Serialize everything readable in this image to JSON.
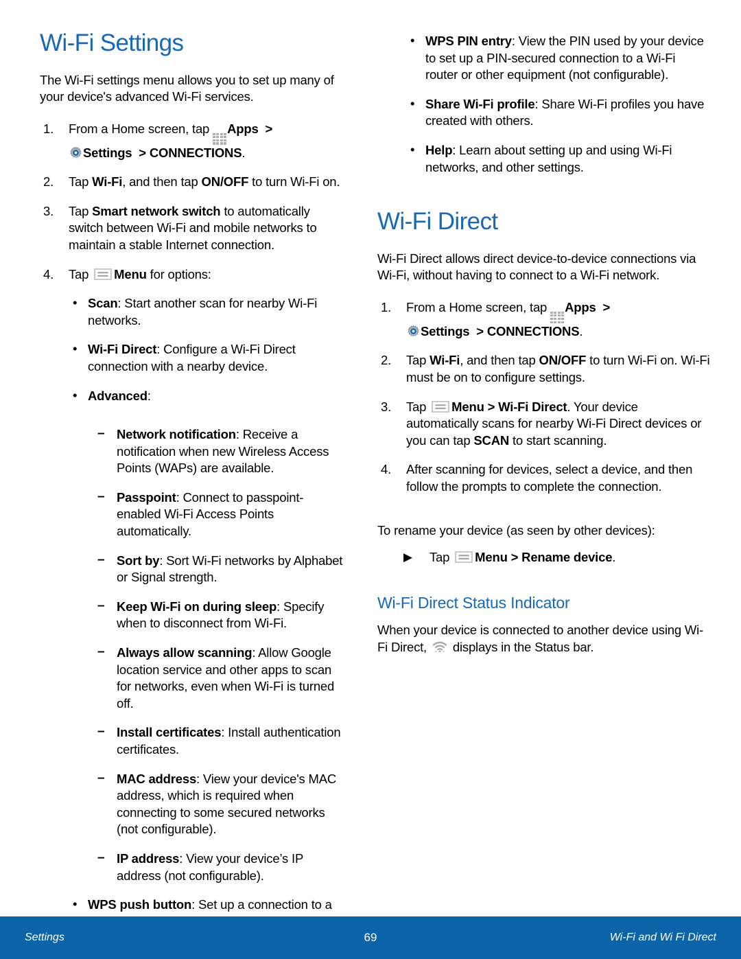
{
  "colors": {
    "heading_blue": "#1569b8",
    "footer_blue": "#0b64a8",
    "icon_gray": "#b0b0b0"
  },
  "left_column": {
    "title": "Wi-Fi Settings",
    "intro": "The Wi-Fi settings menu allows you to set up many of your device's advanced Wi-Fi services.",
    "steps": [
      {
        "num": "1.",
        "pre": "From a Home screen, tap ",
        "apps_label": "Apps",
        "arrow1": ">",
        "settings_label": "Settings",
        "arrow2": ">",
        "connections_label": "CONNECTIONS",
        "period": "."
      },
      {
        "num": "2.",
        "pre": "Tap ",
        "bold1": "Wi-Fi",
        "mid": ", and then tap ",
        "bold2": "ON/OFF",
        "post": " to turn Wi-Fi on."
      },
      {
        "num": "3.",
        "pre": "Tap ",
        "bold1": "Smart network switch",
        "post": " to automatically switch between Wi-Fi and mobile networks to maintain a stable Internet connection."
      },
      {
        "num": "4.",
        "pre": "Tap ",
        "menu_label": "Menu",
        "post": " for options:"
      }
    ],
    "menu_options": [
      {
        "marker": "•",
        "term": "Scan",
        "desc": ": Start another scan for nearby Wi-Fi networks."
      },
      {
        "marker": "•",
        "term": "Wi-Fi Direct",
        "desc": ": Configure a Wi-Fi Direct connection with a nearby device."
      },
      {
        "marker": "•",
        "term": "Advanced",
        "desc": ":"
      }
    ],
    "advanced_options": [
      {
        "marker": "–",
        "term": "Network notification",
        "desc": ": Receive a notification when new Wireless Access Points (WAPs) are available."
      },
      {
        "marker": "–",
        "term": "Passpoint",
        "desc": ": Connect to passpoint-enabled Wi-Fi Access Points automatically."
      },
      {
        "marker": "–",
        "term": "Sort by",
        "desc": ": Sort Wi-Fi networks by Alphabet or Signal strength."
      },
      {
        "marker": "–",
        "term": "Keep Wi-Fi on during sleep",
        "desc": ": Specify when to disconnect from Wi-Fi."
      },
      {
        "marker": "–",
        "term": "Always allow scanning",
        "desc": ": Allow Google location service and other apps to scan for networks, even when Wi-Fi is turned off."
      },
      {
        "marker": "–",
        "term": "Install certificates",
        "desc": ": Install authentication certificates."
      },
      {
        "marker": "–",
        "term": "MAC address",
        "desc": ": View your device's MAC address, which is required when connecting to some secured networks (not configurable)."
      },
      {
        "marker": "–",
        "term": "IP address",
        "desc": ": View your device’s IP address (not configurable)."
      }
    ],
    "menu_options_tail": [
      {
        "marker": "•",
        "term": "WPS push button",
        "desc": ": Set up a connection to a WPS (Wi-Fi Protected Setup) router or other equipment."
      }
    ]
  },
  "right_column": {
    "menu_options_cont": [
      {
        "marker": "•",
        "term": "WPS PIN entry",
        "desc": ": View the PIN used by your device to set up a PIN-secured connection to a Wi-Fi router or other equipment (not configurable)."
      },
      {
        "marker": "•",
        "term": "Share Wi-Fi profile",
        "desc": ": Share Wi-Fi profiles you have created with others."
      },
      {
        "marker": "•",
        "term": "Help",
        "desc": ": Learn about setting up and using Wi-Fi networks, and other settings."
      }
    ],
    "title": "Wi-Fi Direct",
    "intro": "Wi-Fi Direct allows direct device-to-device connections via Wi-Fi, without having to connect to a Wi-Fi network.",
    "steps": [
      {
        "num": "1.",
        "pre": "From a Home screen, tap ",
        "apps_label": "Apps",
        "arrow1": ">",
        "settings_label": "Settings",
        "arrow2": ">",
        "connections_label": "CONNECTIONS",
        "period": "."
      },
      {
        "num": "2.",
        "pre": "Tap ",
        "bold1": "Wi-Fi",
        "mid": ", and then tap ",
        "bold2": "ON/OFF",
        "post": " to turn Wi-Fi on. Wi-Fi must be on to configure settings."
      },
      {
        "num": "3.",
        "pre": "Tap ",
        "menu_label": "Menu",
        "gt": " > ",
        "bold1": "Wi-Fi Direct",
        "mid": ". Your device automatically scans for nearby Wi-Fi Direct devices or you can tap ",
        "bold2": "SCAN",
        "post": " to start scanning."
      },
      {
        "num": "4.",
        "pre": "After scanning for devices, select a device, and then follow the prompts to complete the connection."
      }
    ],
    "rename_intro": "To rename your device (as seen by other devices):",
    "rename_step": {
      "marker": "▶",
      "pre": "Tap ",
      "menu_label": "Menu",
      "gt": " > ",
      "bold1": "Rename device",
      "post": "."
    },
    "status_subtitle": "Wi-Fi Direct Status Indicator",
    "status_text_pre": "When your device is connected to another device using Wi-Fi Direct, ",
    "status_text_post": " displays in the Status bar."
  },
  "footer": {
    "left": "Settings",
    "page_number": "69",
    "right": "Wi-Fi and Wi Fi Direct"
  }
}
